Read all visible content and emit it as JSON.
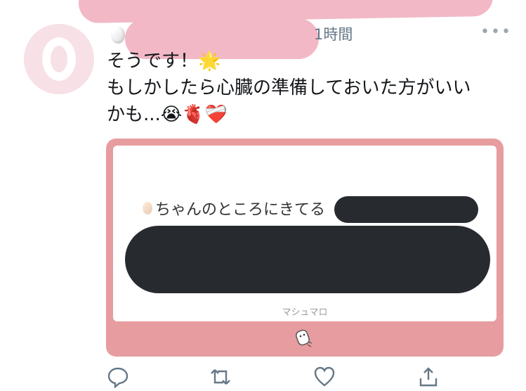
{
  "tweet": {
    "time": "1時間",
    "more": "•••",
    "lines": [
      "そうです！🌟",
      "もしかしたら心臓の準備しておいた方がいい",
      "かも...😭🫀❤️‍🩹"
    ]
  },
  "card": {
    "question_prefix": "ちゃんのところにきてる",
    "brand": "マシュマロ"
  },
  "icons": {
    "reply": "reply-icon",
    "retweet": "retweet-icon",
    "like": "heart-icon",
    "share": "share-icon"
  },
  "colors": {
    "card_border": "#e79c9f",
    "redaction_pink": "#f2b8c6",
    "redaction_dark": "#272a2f",
    "meta_gray": "#657786"
  }
}
